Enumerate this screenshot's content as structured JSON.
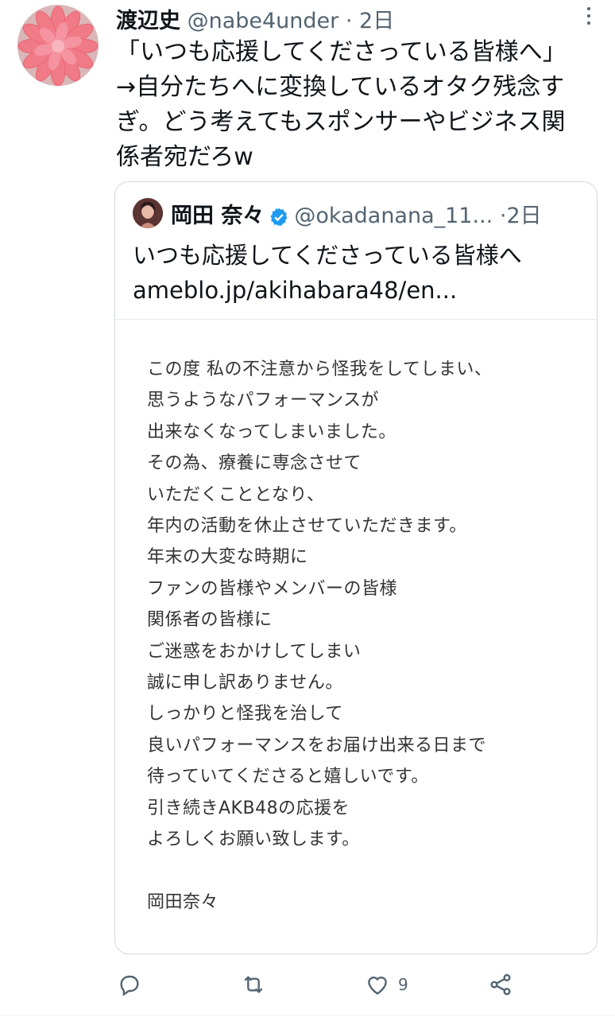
{
  "tweet": {
    "author_name": "渡辺史",
    "author_handle": "@nabe4under",
    "separator": "·",
    "time": "2日",
    "text": "「いつも応援してくださっている皆様へ」\n→自分たちへに変換しているオタク残念す\nぎ。どう考えてもスポンサーやビジネス関\n係者宛だろw"
  },
  "quote": {
    "author_name": "岡田 奈々",
    "author_handle": "@okadanana_11...",
    "separator": "·",
    "time": "2日",
    "text": "いつも応援してくださっている皆様へ",
    "link": "ameblo.jp/akihabara48/en...",
    "card_text": "この度 私の不注意から怪我をしてしまい、\n思うようなパフォーマンスが\n出来なくなってしまいました。\nその為、療養に専念させて\nいただくこととなり、\n年内の活動を休止させていただきます。\n年末の大変な時期に\nファンの皆様やメンバーの皆様\n関係者の皆様に\nご迷惑をおかけしてしまい\n誠に申し訳ありません。\nしっかりと怪我を治して\n良いパフォーマンスをお届け出来る日まで\n待っていてくださると嬉しいです。\n引き続きAKB48の応援を\nよろしくお願い致します。\n\n岡田奈々"
  },
  "actions": {
    "reply_icon": "reply-icon",
    "retweet_icon": "retweet-icon",
    "like_icon": "heart-icon",
    "like_count": "9",
    "share_icon": "share-icon"
  },
  "colors": {
    "text": "#0f1419",
    "muted": "#536471",
    "verified": "#1d9bf0",
    "border": "#cfd9de"
  }
}
